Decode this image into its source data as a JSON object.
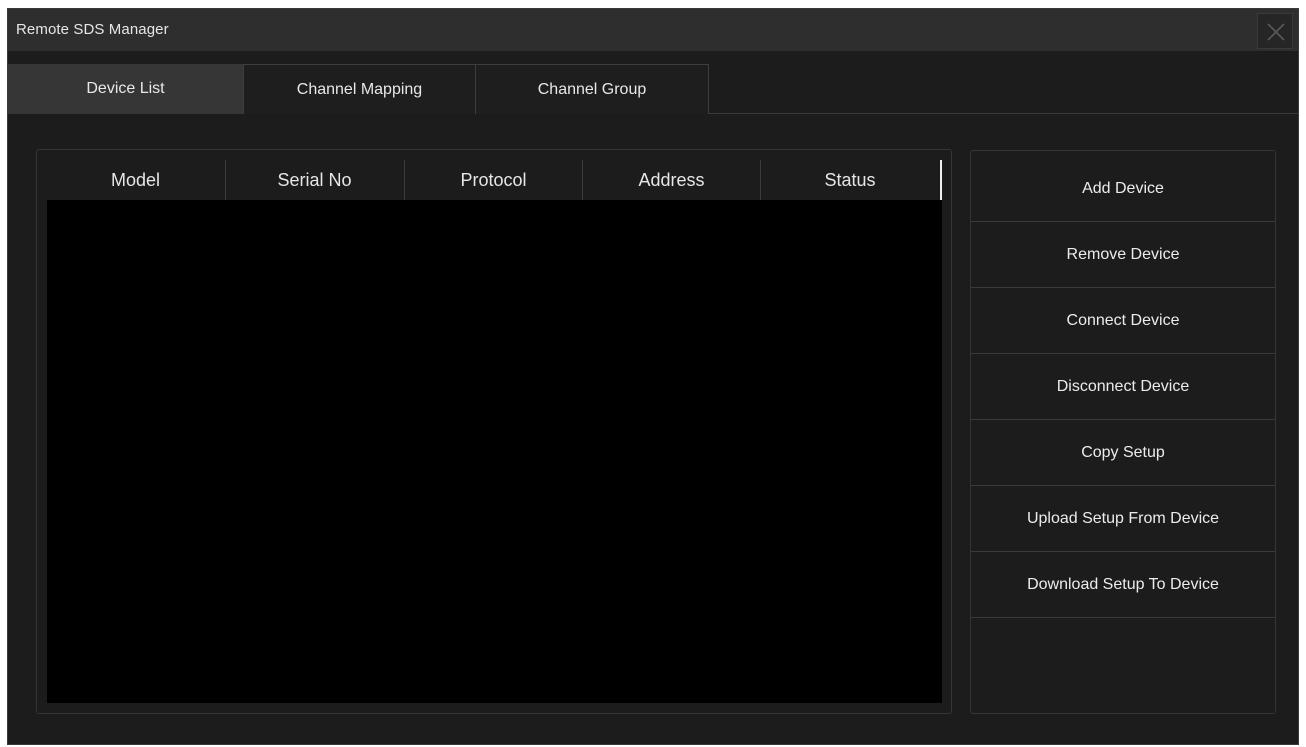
{
  "window": {
    "title": "Remote SDS Manager"
  },
  "tabs": [
    {
      "label": "Device List",
      "active": true
    },
    {
      "label": "Channel Mapping",
      "active": false
    },
    {
      "label": "Channel Group",
      "active": false
    }
  ],
  "table": {
    "columns": [
      "Model",
      "Serial No",
      "Protocol",
      "Address",
      "Status"
    ],
    "rows": []
  },
  "actions": {
    "add_device": "Add Device",
    "remove_device": "Remove Device",
    "connect_device": "Connect Device",
    "disconnect_device": "Disconnect Device",
    "copy_setup": "Copy Setup",
    "upload_setup": "Upload Setup From Device",
    "download_setup": "Download Setup To Device"
  },
  "colors": {
    "window_bg": "#1c1c1c",
    "titlebar_bg": "#2e2e2e",
    "active_tab_bg": "#363636",
    "table_body_bg": "#000000",
    "text": "#e6e6e6"
  },
  "icons": {
    "close": "close-icon"
  }
}
